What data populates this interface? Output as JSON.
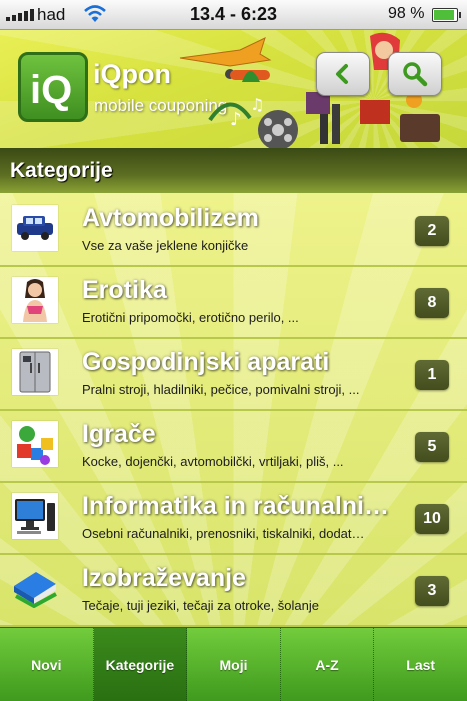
{
  "status_bar": {
    "carrier": "had",
    "time": "13.4 - 6:23",
    "battery": "98 %",
    "battery_level": 0.98
  },
  "header": {
    "logo_text": "iQpon",
    "logo_subtitle": "mobile couponing",
    "back_icon": "chevron-left-icon",
    "search_icon": "magnifier-icon"
  },
  "section": {
    "title": "Kategorije"
  },
  "categories": [
    {
      "title": "Avtomobilizem",
      "subtitle": "Vse za vaše jeklene konjičke",
      "count": "2",
      "icon": "car-icon"
    },
    {
      "title": "Erotika",
      "subtitle": "Erotični pripomočki, erotično perilo, ...",
      "count": "8",
      "icon": "woman-icon"
    },
    {
      "title": "Gospodinjski aparati",
      "subtitle": "Pralni stroji, hladilniki, pečice, pomivalni stroji, ...",
      "count": "1",
      "icon": "fridge-icon"
    },
    {
      "title": "Igrače",
      "subtitle": "Kocke, dojenčki, avtomobilčki, vrtiljaki, pliš, ...",
      "count": "5",
      "icon": "toys-icon"
    },
    {
      "title": "Informatika in računalni…",
      "subtitle": "Osebni računalniki, prenosniki, tiskalniki, dodat…",
      "count": "10",
      "icon": "computer-icon"
    },
    {
      "title": "Izobraževanje",
      "subtitle": "Tečaje, tuji jeziki, tečaji za otroke, šolanje",
      "count": "3",
      "icon": "books-icon"
    }
  ],
  "tabs": [
    {
      "label": "Novi",
      "active": false
    },
    {
      "label": "Kategorije",
      "active": true
    },
    {
      "label": "Moji",
      "active": false
    },
    {
      "label": "A-Z",
      "active": false
    },
    {
      "label": "Last",
      "active": false
    }
  ]
}
